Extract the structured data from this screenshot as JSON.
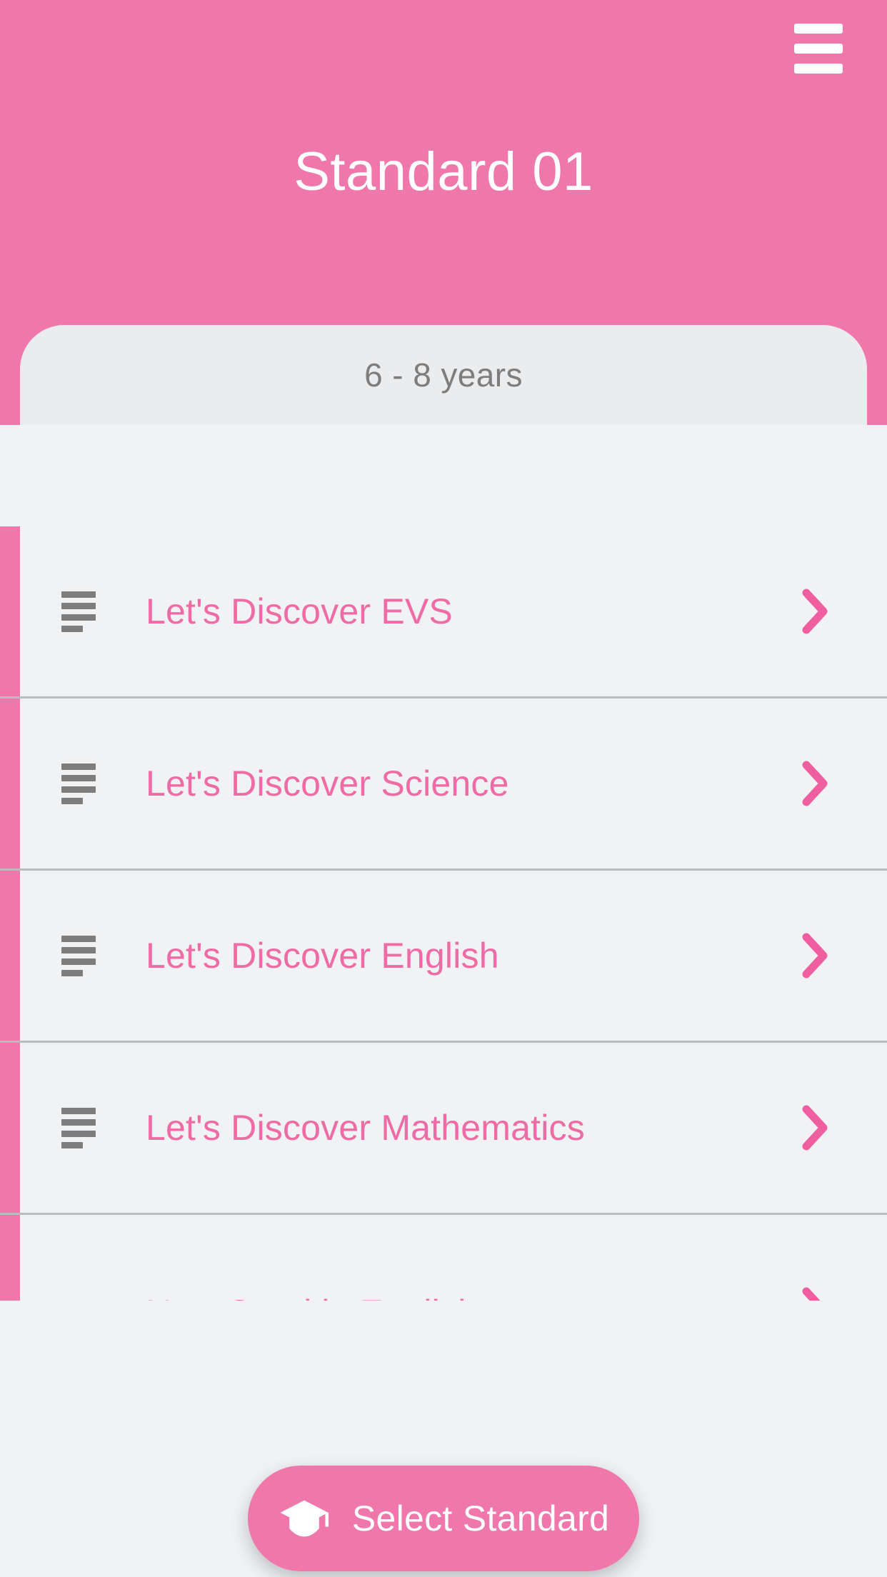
{
  "header": {
    "title": "Standard 01",
    "menu_icon": "hamburger-menu-icon",
    "background_color": "#ef77ab"
  },
  "subheader": {
    "age_range": "6 - 8 years",
    "background_color": "#ebecee",
    "text_color": "#7d7d7d"
  },
  "list": {
    "accent_color": "#ef77ab",
    "row_background": "#f0f2f4",
    "label_color": "#ef6ba5",
    "item_icon": "list-lines-icon",
    "chevron_icon": "chevron-right-icon",
    "items": [
      {
        "label": "Let's Discover EVS"
      },
      {
        "label": "Let's Discover Science"
      },
      {
        "label": "Let's Discover English"
      },
      {
        "label": "Let's Discover Mathematics"
      },
      {
        "label": "New Sparkle English"
      }
    ]
  },
  "fab": {
    "label": "Select Standard",
    "icon": "graduation-cap-icon",
    "background_color": "#ef77ab",
    "text_color": "#ffffff"
  }
}
